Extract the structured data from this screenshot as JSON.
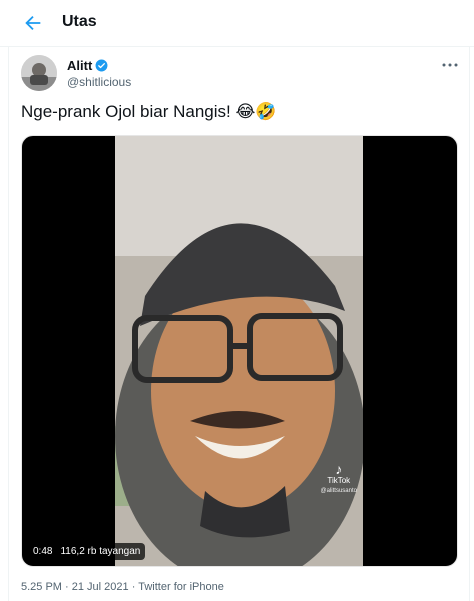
{
  "header": {
    "title": "Utas",
    "back_icon": "arrow-left-icon"
  },
  "author": {
    "name": "Alitt",
    "handle": "@shitlicious",
    "verified": true,
    "verified_icon": "verified-badge-icon",
    "more_icon": "more-horizontal-icon"
  },
  "tweet": {
    "text": "Nge-prank Ojol biar Nangis! 😂🤣"
  },
  "video": {
    "duration": "0:48",
    "views": "116,2 rb tayangan",
    "watermark_brand": "TikTok",
    "watermark_user": "@alittsusanto"
  },
  "meta": {
    "time": "5.25 PM",
    "separator": "·",
    "date": "21 Jul 2021",
    "app": "Twitter for iPhone"
  },
  "colors": {
    "accent": "#1d9bf0",
    "text": "#0f1419",
    "secondary": "#536471"
  }
}
